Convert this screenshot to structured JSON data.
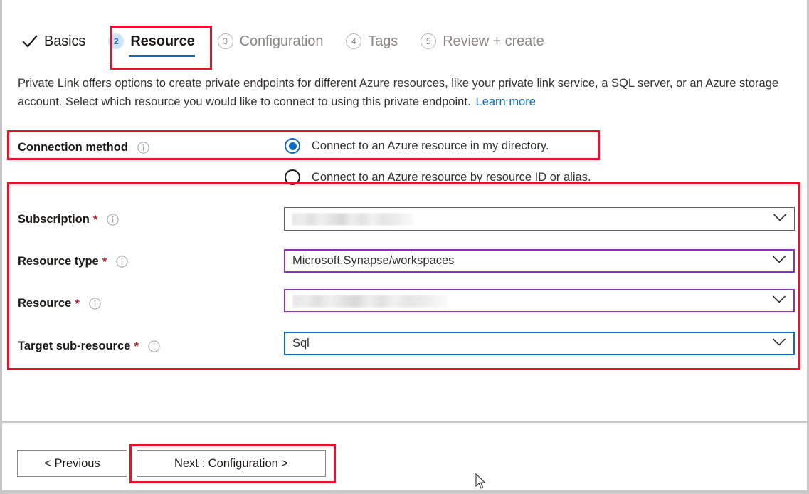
{
  "wizard": {
    "tabs": [
      {
        "label": "Basics",
        "state": "completed",
        "icon": "check-icon",
        "number": ""
      },
      {
        "label": "Resource",
        "state": "active",
        "icon": "",
        "number": "2"
      },
      {
        "label": "Configuration",
        "state": "upcoming",
        "icon": "",
        "number": "3"
      },
      {
        "label": "Tags",
        "state": "upcoming",
        "icon": "",
        "number": "4"
      },
      {
        "label": "Review + create",
        "state": "upcoming",
        "icon": "",
        "number": "5"
      }
    ]
  },
  "description": {
    "text": "Private Link offers options to create private endpoints for different Azure resources, like your private link service, a SQL server, or an Azure storage account. Select which resource you would like to connect to using this private endpoint.",
    "learn_more": "Learn more"
  },
  "connection_method": {
    "label": "Connection method",
    "info_icon": "info-icon",
    "options": [
      {
        "label": "Connect to an Azure resource in my directory.",
        "selected": true
      },
      {
        "label": "Connect to an Azure resource by resource ID or alias.",
        "selected": false
      }
    ]
  },
  "fields": [
    {
      "label": "Subscription",
      "required": "*",
      "info_icon": "info-icon",
      "value": "",
      "redacted": true,
      "border": "default",
      "chevron": "chevron-down-icon"
    },
    {
      "label": "Resource type",
      "required": "*",
      "info_icon": "info-icon",
      "value": "Microsoft.Synapse/workspaces",
      "redacted": false,
      "border": "purple",
      "chevron": "chevron-down-icon"
    },
    {
      "label": "Resource",
      "required": "*",
      "info_icon": "info-icon",
      "value": "",
      "redacted": true,
      "border": "purple",
      "chevron": "chevron-down-icon"
    },
    {
      "label": "Target sub-resource",
      "required": "*",
      "info_icon": "info-icon",
      "value": "Sql",
      "redacted": false,
      "border": "blue",
      "chevron": "chevron-down-icon"
    }
  ],
  "footer": {
    "previous_label": "< Previous",
    "next_label": "Next : Configuration >"
  },
  "colors": {
    "accent_blue": "#0f6cbd",
    "annotation_red": "#e8112d",
    "focus_purple": "#8d2fbf",
    "required_red": "#a4262c",
    "muted_gray": "#8a8886"
  },
  "annotations": [
    {
      "name": "resource-tab-highlight"
    },
    {
      "name": "connection-method-highlight"
    },
    {
      "name": "resource-fields-highlight"
    },
    {
      "name": "next-button-highlight"
    }
  ],
  "cursor": {
    "icon": "mouse-pointer-icon"
  }
}
